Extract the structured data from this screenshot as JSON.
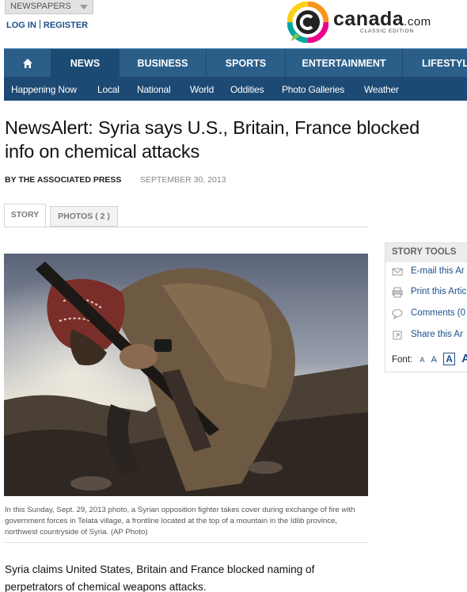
{
  "utility": {
    "newspapers_label": "NEWSPAPERS",
    "login": "LOG IN",
    "register": "REGISTER"
  },
  "logo": {
    "brand": "canada",
    "dotcom": ".com",
    "edition": "CLASSIC EDITION",
    "colors": {
      "ring_orange": "#f7941d",
      "ring_yellow": "#fcd116",
      "ring_teal": "#00a99d",
      "ring_pink": "#ec008c",
      "ring_green": "#8dc63f"
    }
  },
  "nav": {
    "home_icon": "home-icon",
    "items": [
      "NEWS",
      "BUSINESS",
      "SPORTS",
      "ENTERTAINMENT",
      "LIFESTYLE"
    ],
    "active": "NEWS",
    "sub_items": [
      "Happening Now",
      "Local",
      "National",
      "World",
      "Oddities",
      "Photo Galleries",
      "Weather"
    ],
    "colors": {
      "primary": "#2b5f8a",
      "active": "#1b4a72",
      "sub": "#1d4a74"
    }
  },
  "article": {
    "headline": "NewsAlert: Syria says U.S., Britain, France blocked info on chemical attacks",
    "headline_line1": "NewsAlert: Syria says U.S., Britain, France blocked",
    "headline_line2": "info on chemical attacks",
    "byline": "BY THE ASSOCIATED PRESS",
    "date": "SEPTEMBER 30, 2013",
    "tabs": {
      "story": "STORY",
      "photos": "PHOTOS ( 2 )"
    },
    "caption": "In this Sunday, Sept. 29, 2013 photo, a Syrian opposition fighter takes cover during exchange of fire with government forces in Telata village, a frontline located at the top of a mountain in the Idlib province, northwest countryside of Syria. (AP Photo)",
    "body_line1": "Syria claims United States, Britain and France blocked naming of",
    "body_line2": "perpetrators of chemical weapons attacks."
  },
  "story_tools": {
    "title": "STORY TOOLS",
    "items": [
      {
        "icon": "email-icon",
        "label": "E-mail this Ar"
      },
      {
        "icon": "print-icon",
        "label": "Print this Artic"
      },
      {
        "icon": "comment-icon",
        "label": "Comments (0"
      },
      {
        "icon": "share-icon",
        "label": "Share this Ar"
      }
    ],
    "font_label": "Font:",
    "font_sizes": [
      "A",
      "A",
      "A",
      "A"
    ]
  }
}
